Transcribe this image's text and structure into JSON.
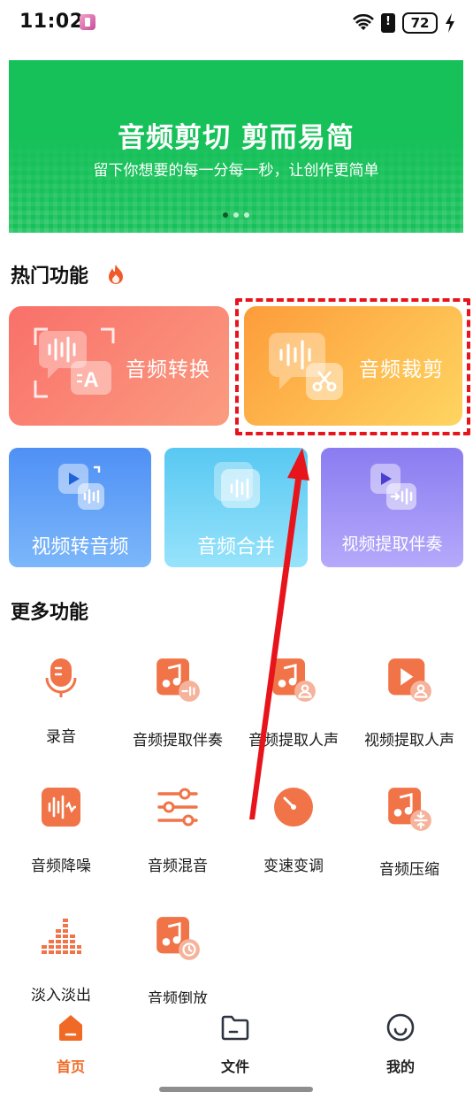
{
  "status_bar": {
    "time": "11:02",
    "battery": "72"
  },
  "banner": {
    "title": "音频剪切 剪而易简",
    "subtitle": "留下你想要的每一分每一秒，让创作更简单",
    "dots": 3,
    "active_dot": 0
  },
  "hot": {
    "title": "热门功能",
    "cards": [
      {
        "label": "音频转换"
      },
      {
        "label": "音频裁剪"
      },
      {
        "label": "视频转音频"
      },
      {
        "label": "音频合并"
      },
      {
        "label": "视频提取伴奏"
      }
    ]
  },
  "more": {
    "title": "更多功能",
    "items": [
      {
        "label": "录音",
        "icon": "microphone-icon"
      },
      {
        "label": "音频提取伴奏",
        "icon": "music-extract-accompaniment-icon"
      },
      {
        "label": "音频提取人声",
        "icon": "music-extract-vocal-icon"
      },
      {
        "label": "视频提取人声",
        "icon": "video-extract-vocal-icon"
      },
      {
        "label": "音频降噪",
        "icon": "noise-reduction-icon"
      },
      {
        "label": "音频混音",
        "icon": "mixer-sliders-icon"
      },
      {
        "label": "变速变调",
        "icon": "speed-dial-icon"
      },
      {
        "label": "音频压缩",
        "icon": "music-compress-icon"
      },
      {
        "label": "淡入淡出",
        "icon": "fade-equalizer-icon"
      },
      {
        "label": "音频倒放",
        "icon": "music-reverse-icon"
      }
    ]
  },
  "bottom_nav": {
    "items": [
      {
        "label": "首页",
        "icon": "home-icon",
        "active": true
      },
      {
        "label": "文件",
        "icon": "folder-icon",
        "active": false
      },
      {
        "label": "我的",
        "icon": "smile-face-icon",
        "active": false
      }
    ]
  },
  "colors": {
    "accent": "#f06a25",
    "banner_green": "#17c15a",
    "highlight_red": "#e8141b"
  }
}
